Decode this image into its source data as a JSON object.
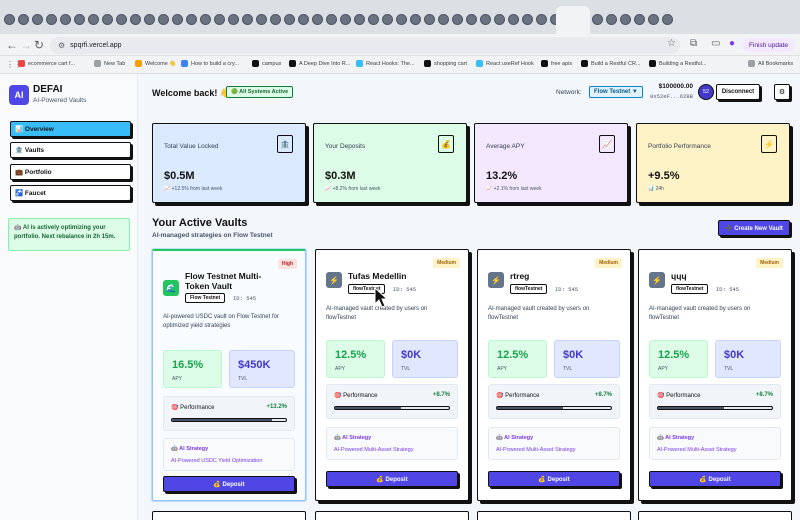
{
  "browser": {
    "url": "spqrfi.vercel.app",
    "finish_update": "Finish update",
    "bookmarks": [
      "ecommerce cart f...",
      "New Tab",
      "Welcome 👋",
      "How to build a cry...",
      "campus",
      "A Deep Dive Into R...",
      "React Hooks: The...",
      "shopping cart",
      "React useRef Hook",
      "free apis",
      "Build a Restful CR...",
      "Building a Restful..."
    ],
    "all_bookmarks": "All Bookmarks"
  },
  "sidebar": {
    "logo": "AI",
    "brand": "DEFAI",
    "tagline": "AI-Powered Vaults",
    "nav": [
      "📊 Overview",
      "🏦 Vaults",
      "💼 Portfolio",
      "🚰 Faucet"
    ],
    "ai_note": "🤖 AI is actively optimizing your portfolio. Next rebalance in 2h 15m."
  },
  "header": {
    "welcome": "Welcome back! 👋",
    "system_badge": "🟢 All Systems Active",
    "network_label": "Network:",
    "network_value": "Flow Testnet ▼",
    "balance": "$100000.00",
    "address": "0x52eF...628B",
    "avatar": "52",
    "disconnect": "Disconnect",
    "settings_icon": "⚙"
  },
  "stats": [
    {
      "label": "Total Value Locked",
      "icon": "🏦",
      "value": "$0.5M",
      "change": "📈 +12.5% from last week",
      "bg": "#dbeafe"
    },
    {
      "label": "Your Deposits",
      "icon": "💰",
      "value": "$0.3M",
      "change": "📈 +8.2% from last week",
      "bg": "#dcfce7"
    },
    {
      "label": "Average APY",
      "icon": "📈",
      "value": "13.2%",
      "change": "📈 +2.1% from last week",
      "bg": "#f3e8ff"
    },
    {
      "label": "Portfolio Performance",
      "icon": "⚡",
      "value": "+9.5%",
      "change": "📊 24h",
      "bg": "#fef3c7"
    }
  ],
  "vaults_section": {
    "title": "Your Active Vaults",
    "subtitle": "AI-managed strategies on Flow Testnet",
    "create_button": "➕ Create New Vault"
  },
  "vaults": [
    {
      "name": "Flow Testnet Multi-Token Vault",
      "risk": "High",
      "network": "Flow Testnet",
      "id": "ID: 545",
      "description": "AI-powered USDC vault on Flow Testnet for optimized yield strategies",
      "apy": "16.5%",
      "apy_label": "APY",
      "tvl": "$450K",
      "tvl_label": "TVL",
      "performance_label": "🎯 Performance",
      "performance": "+13.2%",
      "performance_fraction": 0.88,
      "strategy_label": "🤖 AI Strategy",
      "strategy": "AI-Powered USDC Yield Optimization",
      "deposit": "💰 Deposit",
      "icon": "🌊",
      "icon_color": "#22c55e"
    },
    {
      "name": "Tufas Medellin",
      "risk": "Medium",
      "network": "flowTestnet",
      "id": "ID: 545",
      "description": "AI-managed vault created by users on flowTestnet",
      "apy": "12.5%",
      "apy_label": "APY",
      "tvl": "$0K",
      "tvl_label": "TVL",
      "performance_label": "🎯 Performance",
      "performance": "+8.7%",
      "performance_fraction": 0.58,
      "strategy_label": "🤖 AI Strategy",
      "strategy": "AI-Powered Multi-Asset Strategy",
      "deposit": "💰 Deposit",
      "icon": "⚡",
      "icon_color": "#64748b"
    },
    {
      "name": "rtreg",
      "risk": "Medium",
      "network": "flowTestnet",
      "id": "ID: 545",
      "description": "AI-managed vault created by users on flowTestnet",
      "apy": "12.5%",
      "apy_label": "APY",
      "tvl": "$0K",
      "tvl_label": "TVL",
      "performance_label": "🎯 Performance",
      "performance": "+8.7%",
      "performance_fraction": 0.58,
      "strategy_label": "🤖 AI Strategy",
      "strategy": "AI-Powered Multi-Asset Strategy",
      "deposit": "💰 Deposit",
      "icon": "⚡",
      "icon_color": "#64748b"
    },
    {
      "name": "ɥɥɥ",
      "risk": "Medium",
      "network": "flowTestnet",
      "id": "ID: 545",
      "description": "AI-managed vault created by users on flowTestnet",
      "apy": "12.5%",
      "apy_label": "APY",
      "tvl": "$0K",
      "tvl_label": "TVL",
      "performance_label": "🎯 Performance",
      "performance": "+8.7%",
      "performance_fraction": 0.58,
      "strategy_label": "🤖 AI Strategy",
      "strategy": "AI-Powered Multi-Asset Strategy",
      "deposit": "💰 Deposit",
      "icon": "⚡",
      "icon_color": "#64748b"
    }
  ]
}
